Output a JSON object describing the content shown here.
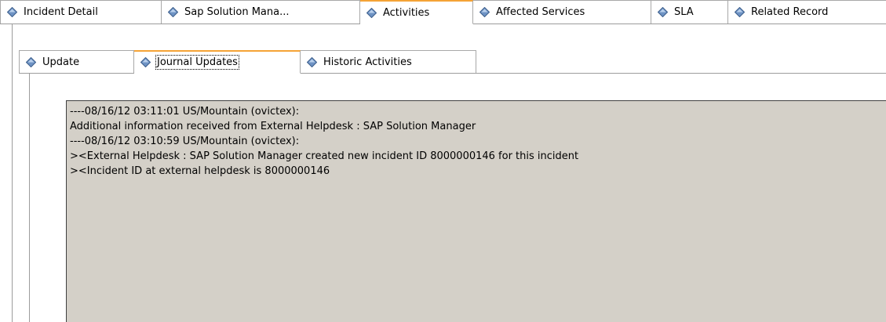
{
  "main_tabs": [
    {
      "label": "Incident Detail",
      "active": false
    },
    {
      "label": "Sap Solution Mana...",
      "active": false
    },
    {
      "label": "Activities",
      "active": true
    },
    {
      "label": "Affected Services",
      "active": false
    },
    {
      "label": "SLA",
      "active": false
    },
    {
      "label": "Related Record",
      "active": false
    }
  ],
  "sub_tabs": [
    {
      "label": "Update",
      "active": false
    },
    {
      "label": "Journal Updates",
      "active": true
    },
    {
      "label": "Historic Activities",
      "active": false
    }
  ],
  "journal": {
    "lines": [
      "----08/16/12 03:11:01 US/Mountain (ovictex):",
      "Additional information received from External Helpdesk : SAP Solution Manager",
      "----08/16/12 03:10:59 US/Mountain (ovictex):",
      "><External Helpdesk : SAP Solution Manager created new incident ID 8000000146 for this incident",
      "><Incident ID at external helpdesk is 8000000146"
    ]
  },
  "colors": {
    "active_tab_accent": "#f5a336",
    "journal_background": "#d4d0c8",
    "tab_icon": "#5f86b8"
  },
  "icons": {
    "tab_icon": "diamond-icon"
  }
}
